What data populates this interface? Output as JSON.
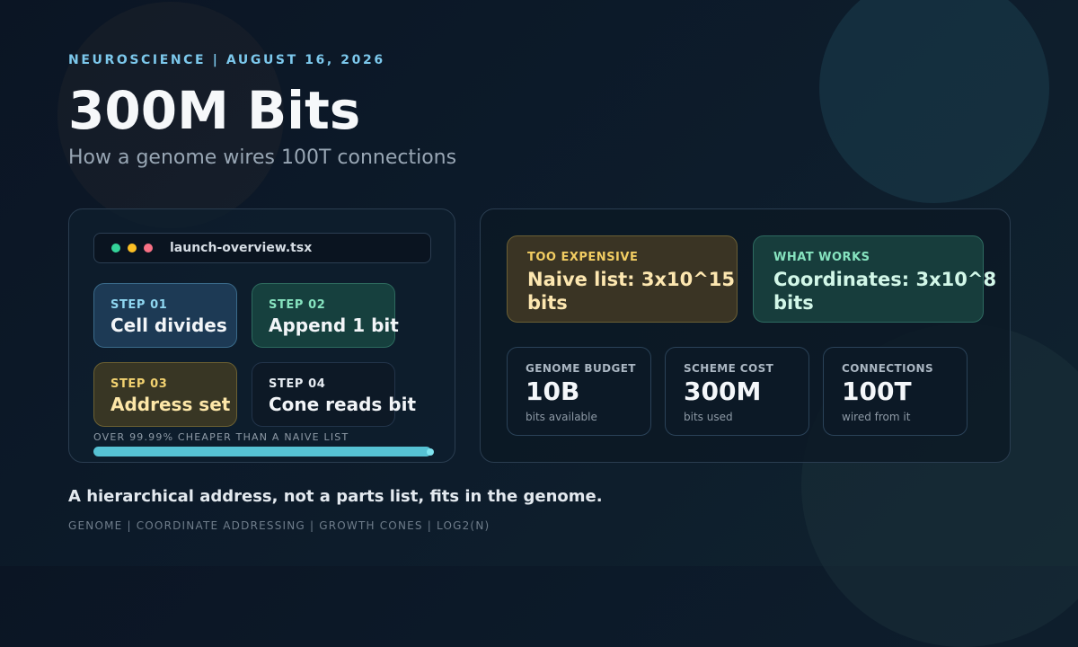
{
  "header": {
    "eyebrow": "NEUROSCIENCE | AUGUST 16, 2026",
    "title": "300M Bits",
    "subtitle": "How a genome wires 100T connections"
  },
  "overview_card": {
    "file_name": "launch-overview.tsx",
    "window_dots": [
      "green-dot-icon",
      "yellow-dot-icon",
      "red-dot-icon"
    ],
    "steps": [
      {
        "label": "STEP 01",
        "value": "Cell divides"
      },
      {
        "label": "STEP 02",
        "value": "Append 1 bit"
      },
      {
        "label": "STEP 03",
        "value": "Address set"
      },
      {
        "label": "STEP 04",
        "value": "Cone reads bit"
      }
    ],
    "progress": {
      "label": "OVER 99.99% CHEAPER THAN A NAIVE LIST",
      "fill_percent": 99.99
    }
  },
  "comparison_card": {
    "expensive": {
      "label": "TOO EXPENSIVE",
      "value": "Naive list: 3x10^15 bits"
    },
    "works": {
      "label": "WHAT WORKS",
      "value": "Coordinates: 3x10^8 bits"
    },
    "stats": [
      {
        "label": "GENOME BUDGET",
        "value": "10B",
        "note": "bits available"
      },
      {
        "label": "SCHEME COST",
        "value": "300M",
        "note": "bits used"
      },
      {
        "label": "CONNECTIONS",
        "value": "100T",
        "note": "wired from it"
      }
    ]
  },
  "footer": {
    "tagline": "A hierarchical address, not a parts list, fits in the genome.",
    "keywords": "GENOME | COORDINATE ADDRESSING | GROWTH CONES | LOG2(N)"
  },
  "colors": {
    "accent": "#7cc8ec",
    "progress": "#56c2d4",
    "warn": "#f2cd62",
    "ok": "#86e3bf"
  }
}
